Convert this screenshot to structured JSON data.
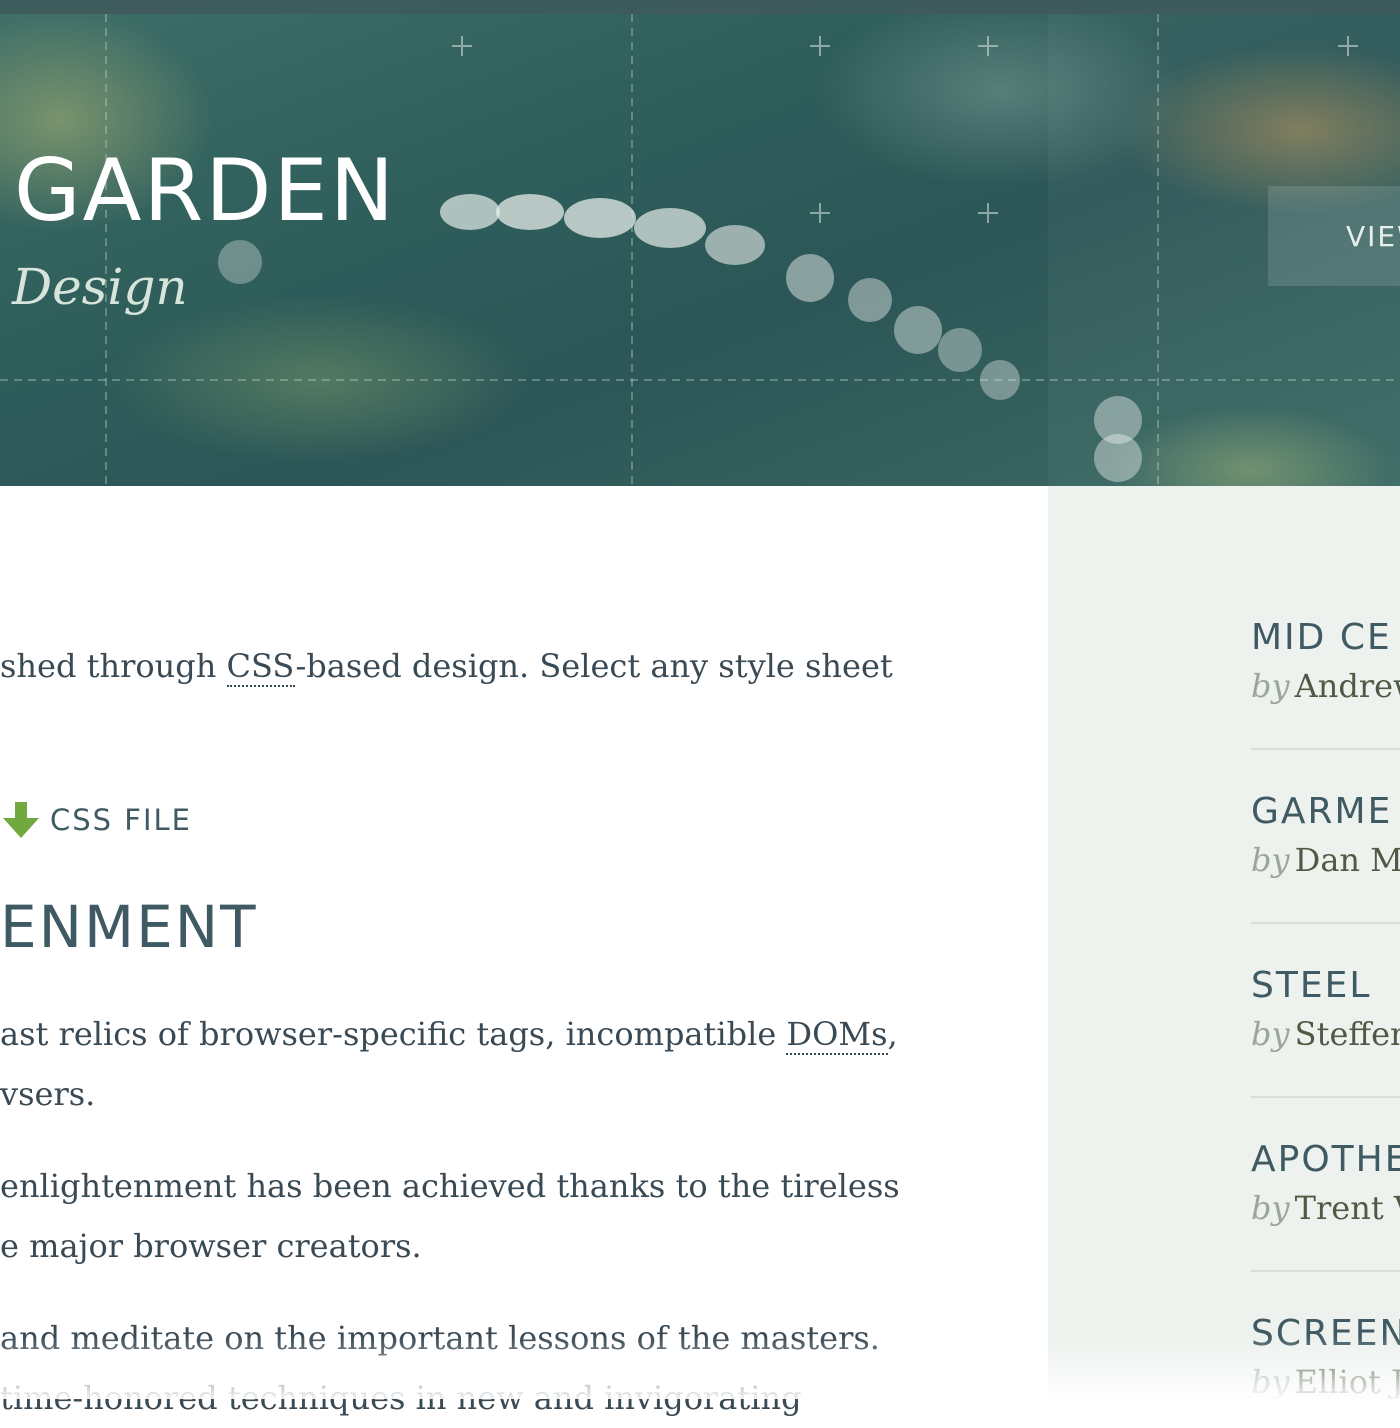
{
  "header": {
    "title": "GARDEN",
    "subtitle": "Design",
    "view_button": "VIEW"
  },
  "main": {
    "intro_prefix": "shed through ",
    "intro_abbr": "CSS",
    "intro_suffix": "-based design. Select any style sheet",
    "download_label": "CSS FILE",
    "section_heading": "ENMENT",
    "p1_line1_prefix": "ast relics of browser-specific tags, incompatible ",
    "p1_line1_abbr": "DOMs",
    "p1_line1_suffix": ",",
    "p1_line2": "vsers.",
    "p2_line1": "enlightenment has been achieved thanks to the tireless",
    "p2_line2": "e major browser creators.",
    "p3_line1": "and meditate on the important lessons of the masters.",
    "p3_line2": "time-honored techniques in new and invigorating"
  },
  "sidebar": {
    "by_word": "by",
    "designs": [
      {
        "name": "MID CE",
        "author": "Andrew"
      },
      {
        "name": "GARME",
        "author": "Dan M"
      },
      {
        "name": "STEEL",
        "author": "Steffen"
      },
      {
        "name": "APOTHE",
        "author": "Trent V"
      },
      {
        "name": "SCREEN",
        "author": "Elliot J"
      }
    ]
  },
  "colors": {
    "header_teal": "#2f5e5b",
    "sidebar_bg": "#edf2ee",
    "heading_text": "#3f5a63",
    "body_text": "#3a4a55",
    "download_arrow": "#72a93f"
  },
  "icons": {
    "download": "download-arrow-icon"
  }
}
